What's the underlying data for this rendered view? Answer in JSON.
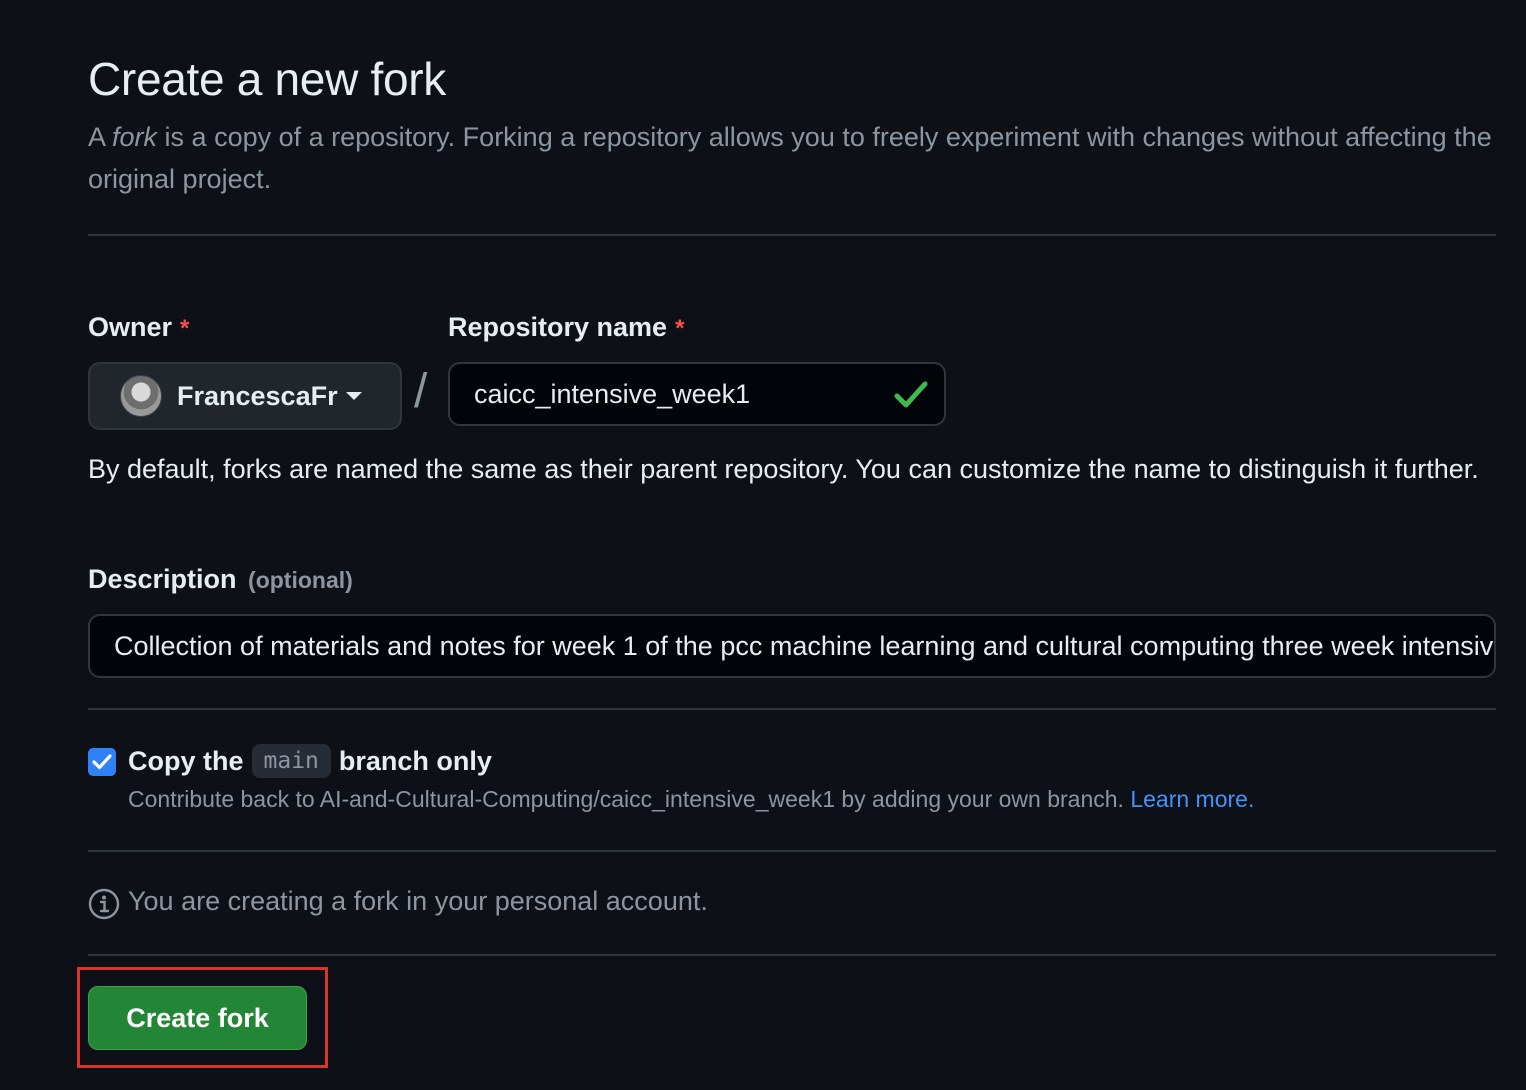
{
  "header": {
    "title": "Create a new fork",
    "intro_prefix": "A ",
    "intro_fork": "fork",
    "intro_rest": " is a copy of a repository. Forking a repository allows you to freely experiment with changes without affecting the original project."
  },
  "owner": {
    "label": "Owner",
    "required_mark": "*",
    "selected": "FrancescaFr"
  },
  "repository": {
    "label": "Repository name",
    "required_mark": "*",
    "value": "caicc_intensive_week1",
    "status_icon": "check-icon"
  },
  "separator": "/",
  "name_help": "By default, forks are named the same as their parent repository. You can customize the name to distinguish it further.",
  "description": {
    "label": "Description",
    "optional": "(optional)",
    "value": "Collection of materials and notes for week 1 of the pcc machine learning and cultural computing three week intensive"
  },
  "copy_branch": {
    "checked": true,
    "label_prefix": "Copy the",
    "branch": "main",
    "label_suffix": "branch only",
    "sub_text": "Contribute back to AI-and-Cultural-Computing/caicc_intensive_week1 by adding your own branch.",
    "learn_more": "Learn more."
  },
  "info": {
    "text": "You are creating a fork in your personal account."
  },
  "actions": {
    "create_label": "Create fork"
  },
  "colors": {
    "background": "#0d1117",
    "primary_button": "#238636",
    "link": "#4493f8",
    "required": "#f85149",
    "highlight_border": "#d8362a",
    "checkbox": "#2f81f7"
  }
}
